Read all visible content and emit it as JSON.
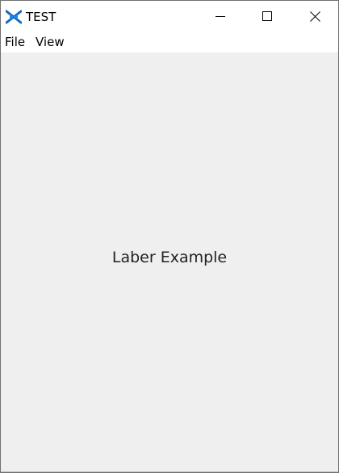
{
  "window": {
    "title": "TEST",
    "app_icon": "app-logo-icon",
    "caption_icons": {
      "minimize": "minimize-icon",
      "maximize": "maximize-icon",
      "close": "close-icon"
    }
  },
  "menubar": {
    "items": [
      {
        "label": "File"
      },
      {
        "label": "View"
      }
    ]
  },
  "content": {
    "label": "Laber Example"
  },
  "colors": {
    "content_background": "#efefef",
    "icon_blue": "#1565c0",
    "window_border": "#707070"
  }
}
